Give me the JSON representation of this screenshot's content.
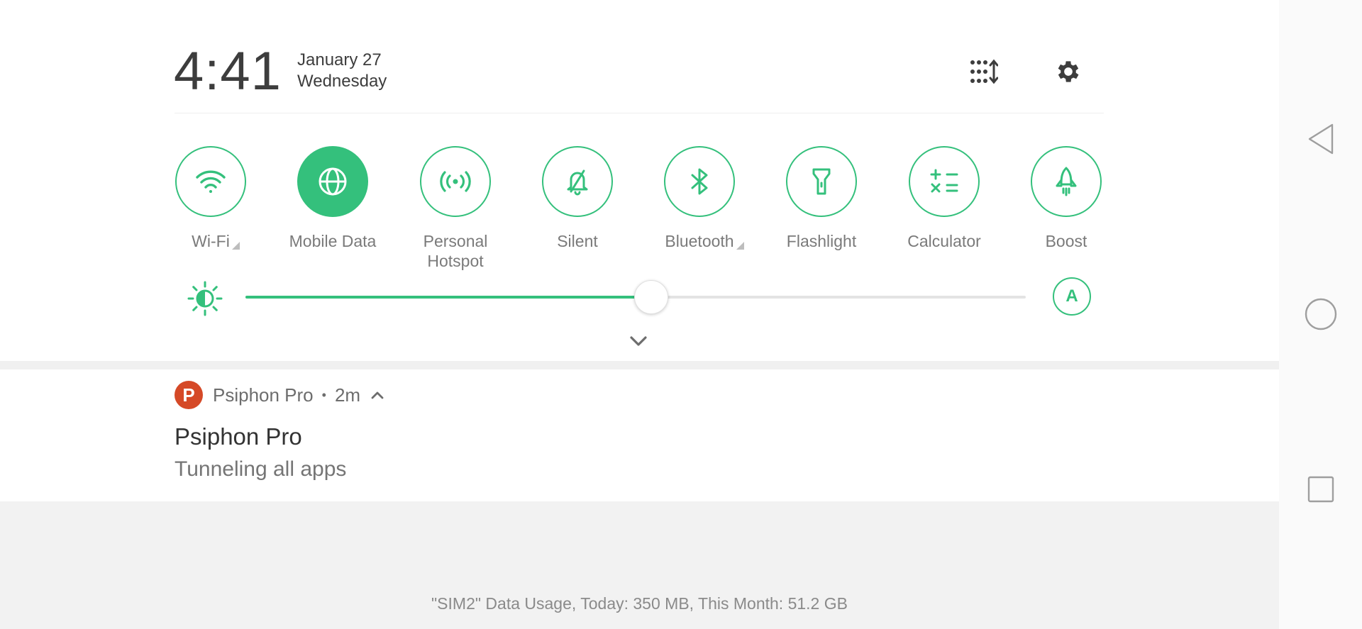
{
  "status": {
    "time": "4:41",
    "date": "January 27",
    "weekday": "Wednesday"
  },
  "header_icons": {
    "edit": "edit-tiles-icon",
    "settings": "gear-icon"
  },
  "tiles": [
    {
      "label": "Wi-Fi",
      "icon": "wifi-icon",
      "active": false,
      "has_menu": true
    },
    {
      "label": "Mobile Data",
      "icon": "globe-icon",
      "active": true,
      "has_menu": false
    },
    {
      "label": "Personal\nHotspot",
      "icon": "hotspot-icon",
      "active": false,
      "has_menu": false
    },
    {
      "label": "Silent",
      "icon": "bell-off-icon",
      "active": false,
      "has_menu": false
    },
    {
      "label": "Bluetooth",
      "icon": "bluetooth-icon",
      "active": false,
      "has_menu": true
    },
    {
      "label": "Flashlight",
      "icon": "flashlight-icon",
      "active": false,
      "has_menu": false
    },
    {
      "label": "Calculator",
      "icon": "calculator-icon",
      "active": false,
      "has_menu": false
    },
    {
      "label": "Boost",
      "icon": "rocket-icon",
      "active": false,
      "has_menu": false
    }
  ],
  "brightness": {
    "icon": "brightness-icon",
    "level": 0.52,
    "auto_label": "A"
  },
  "notification": {
    "app_icon_letter": "P",
    "app_name": "Psiphon Pro",
    "separator": "•",
    "time": "2m",
    "title": "Psiphon Pro",
    "body": "Tunneling all apps"
  },
  "data_usage": "\"SIM2\" Data Usage, Today: 350 MB, This Month: 51.2 GB",
  "colors": {
    "accent": "#34c07c",
    "psiphon": "#d54927"
  }
}
